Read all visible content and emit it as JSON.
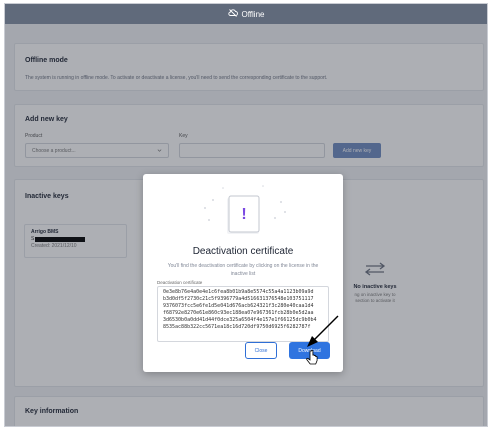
{
  "topbar": {
    "title": "Offline"
  },
  "offline_mode": {
    "title": "Offline mode",
    "description": "The system is running in offline mode. To activate or deactivate a license, you'll need to send the corresponding certificate to the support."
  },
  "add_key": {
    "title": "Add new key",
    "product_label": "Product",
    "product_placeholder": "Choose a product...",
    "key_label": "Key",
    "key_value": "",
    "button_label": "Add new key"
  },
  "inactive_keys": {
    "title": "Inactive keys",
    "item": {
      "name": "Arrigo BMS",
      "serial_prefix": "S",
      "created": "Created: 2021/12/10"
    },
    "empty_title": "No inactive keys",
    "empty_line1": "ng on inactive key to",
    "empty_line2": "section to activate it"
  },
  "key_information": {
    "title": "Key information"
  },
  "modal": {
    "icon_symbol": "!",
    "title": "Deactivation certificate",
    "description": "You'll find the deactivation certificate by clicking on the license in the inactive list",
    "certificate_label": "Deactivation certificate",
    "certificate_lines": [
      "0e3e8b76e4a0e4e1c6fea8b01b9a8e5574c55a4a1123b09a9d",
      "b3d0df5f2730c21c5f9396779a4d516631376548e103751117",
      "9376073fcc5e6fe1d5e041d676acb624321f3c280e40caa1d4",
      "f68792e8270e61e860c93ec188ea07e967361fcb28b0e5d2aa",
      "3d6530b0a0dd41d44f0dce325a6504f4e157e1f66125dc9b0b4",
      "8535ac88b322cc5671ea18c16d720df9750d6925f6282787f"
    ],
    "close_label": "Close",
    "download_label": "Download"
  }
}
